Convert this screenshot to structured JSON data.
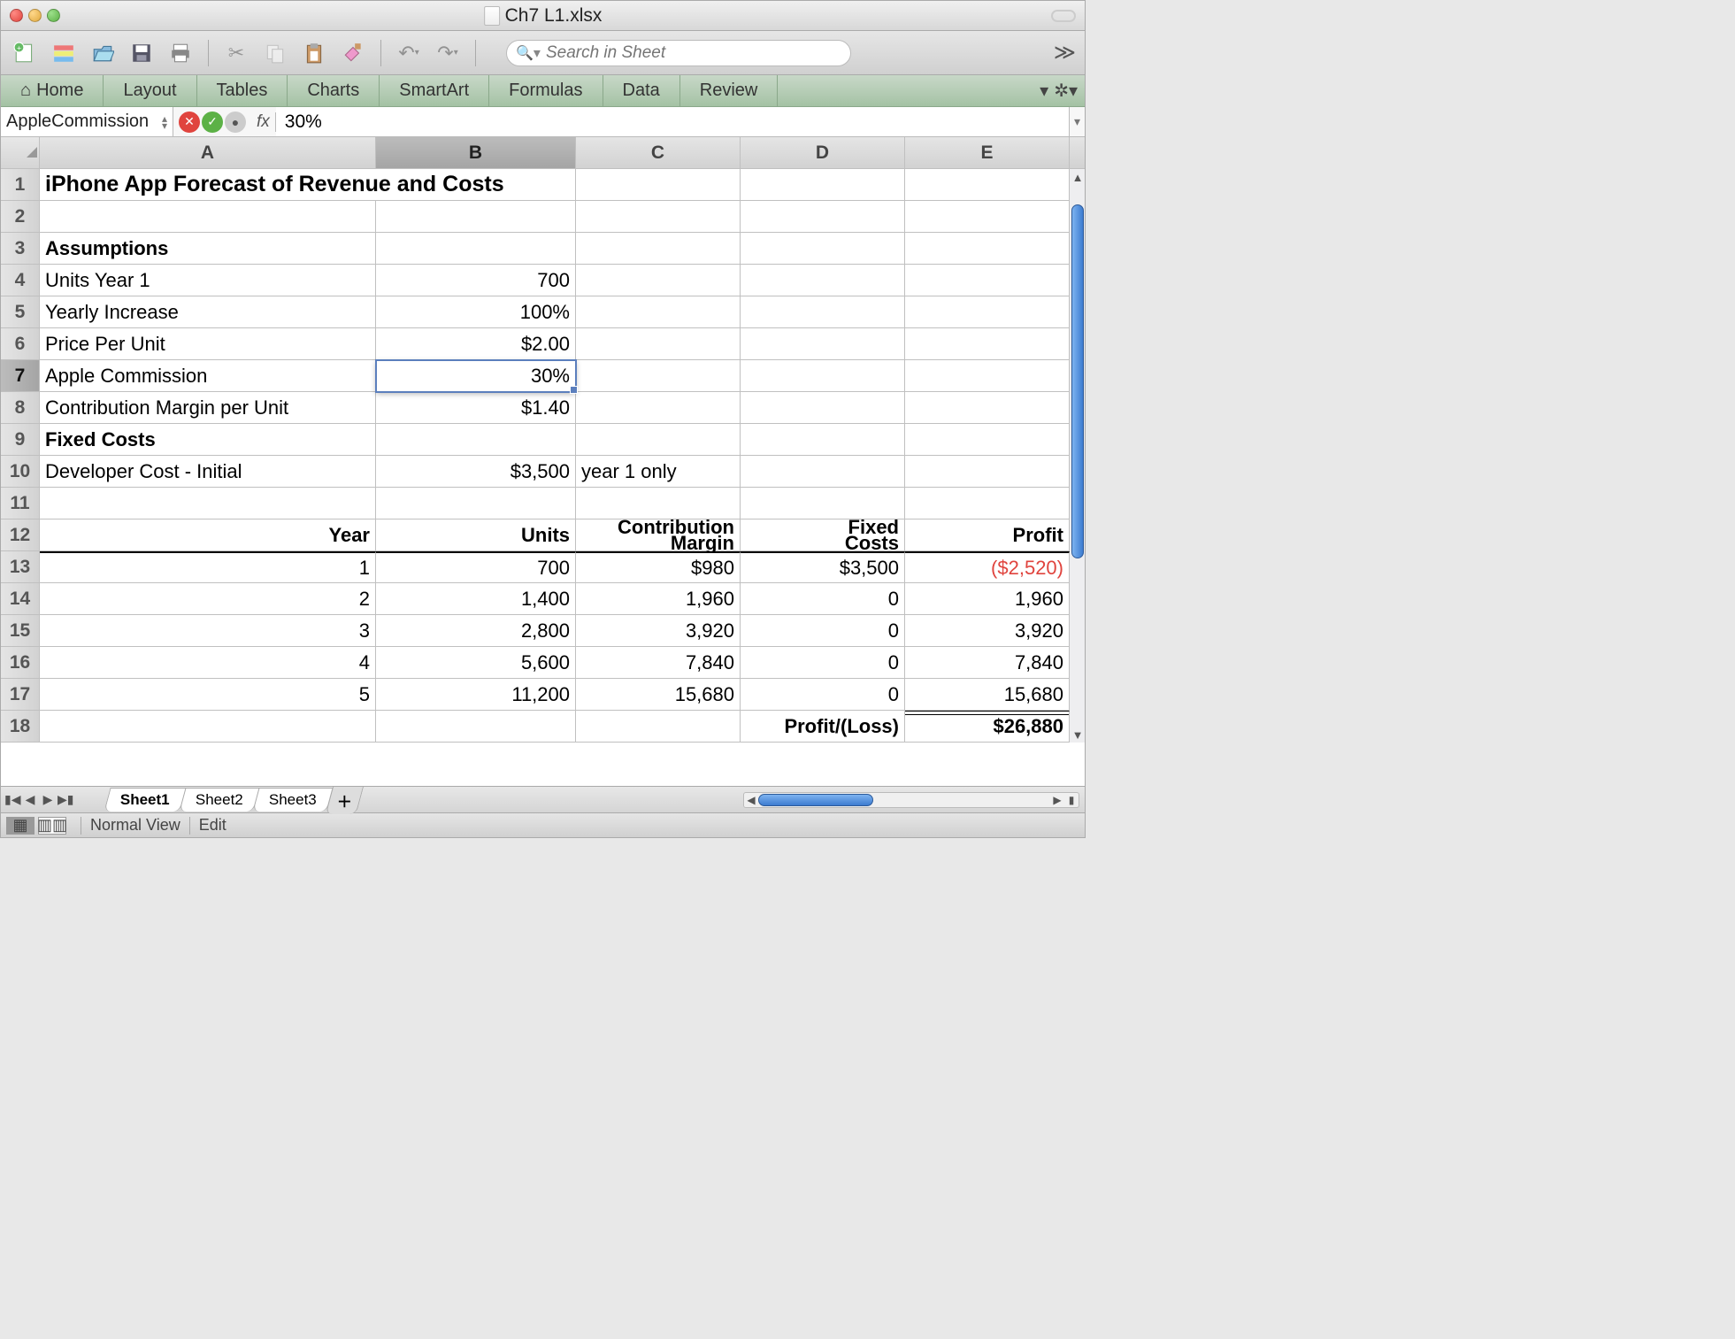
{
  "window": {
    "title": "Ch7 L1.xlsx"
  },
  "toolbar": {
    "search_placeholder": "Search in Sheet"
  },
  "ribbon": {
    "tabs": [
      "Home",
      "Layout",
      "Tables",
      "Charts",
      "SmartArt",
      "Formulas",
      "Data",
      "Review"
    ]
  },
  "formula_bar": {
    "name_box": "AppleCommission",
    "fx_label": "fx",
    "value": "30%"
  },
  "grid": {
    "columns": [
      "A",
      "B",
      "C",
      "D",
      "E"
    ],
    "selected_row": 7,
    "selected_col": "B",
    "rows": [
      {
        "n": 1,
        "A": "iPhone App Forecast of Revenue and Costs",
        "A_style": "title1 bold",
        "span": 2
      },
      {
        "n": 2
      },
      {
        "n": 3,
        "A": "Assumptions",
        "A_style": "bold"
      },
      {
        "n": 4,
        "A": "Units Year 1",
        "B": "700",
        "B_align": "right"
      },
      {
        "n": 5,
        "A": "Yearly Increase",
        "B": "100%",
        "B_align": "right"
      },
      {
        "n": 6,
        "A": "Price Per Unit",
        "B": "$2.00",
        "B_align": "right"
      },
      {
        "n": 7,
        "A": "Apple Commission",
        "B": "30%",
        "B_align": "right",
        "B_sel": true
      },
      {
        "n": 8,
        "A": "Contribution Margin per Unit",
        "B": "$1.40",
        "B_align": "right"
      },
      {
        "n": 9,
        "A": "Fixed  Costs",
        "A_style": "bold"
      },
      {
        "n": 10,
        "A": "Developer Cost - Initial",
        "B": "$3,500",
        "B_align": "right",
        "C": "year 1 only"
      },
      {
        "n": 11
      },
      {
        "n": 12,
        "A": "Year",
        "A_align": "right",
        "A_style": "bold",
        "B": "Units",
        "B_align": "right",
        "B_style": "bold",
        "C": "Contribution Margin",
        "C_align": "right",
        "C_style": "bold",
        "C_two": true,
        "D": "Fixed Costs",
        "D_align": "right",
        "D_style": "bold",
        "D_two": true,
        "E": "Profit",
        "E_align": "right",
        "E_style": "bold"
      },
      {
        "n": 13,
        "top": true,
        "A": "1",
        "A_align": "right",
        "B": "700",
        "B_align": "right",
        "C": "$980",
        "C_align": "right",
        "D": "$3,500",
        "D_align": "right",
        "E": "($2,520)",
        "E_align": "right",
        "E_style": "red"
      },
      {
        "n": 14,
        "A": "2",
        "A_align": "right",
        "B": "1,400",
        "B_align": "right",
        "C": "1,960",
        "C_align": "right",
        "D": "0",
        "D_align": "right",
        "E": "1,960",
        "E_align": "right"
      },
      {
        "n": 15,
        "A": "3",
        "A_align": "right",
        "B": "2,800",
        "B_align": "right",
        "C": "3,920",
        "C_align": "right",
        "D": "0",
        "D_align": "right",
        "E": "3,920",
        "E_align": "right"
      },
      {
        "n": 16,
        "A": "4",
        "A_align": "right",
        "B": "5,600",
        "B_align": "right",
        "C": "7,840",
        "C_align": "right",
        "D": "0",
        "D_align": "right",
        "E": "7,840",
        "E_align": "right"
      },
      {
        "n": 17,
        "A": "5",
        "A_align": "right",
        "B": "11,200",
        "B_align": "right",
        "C": "15,680",
        "C_align": "right",
        "D": "0",
        "D_align": "right",
        "E": "15,680",
        "E_align": "right"
      },
      {
        "n": 18,
        "D": "Profit/(Loss)",
        "D_align": "right",
        "D_style": "bold",
        "E": "$26,880",
        "E_align": "right",
        "E_style": "bold",
        "E_dbl": true
      }
    ]
  },
  "sheets": {
    "tabs": [
      "Sheet1",
      "Sheet2",
      "Sheet3"
    ],
    "active": 0
  },
  "status": {
    "view": "Normal View",
    "mode": "Edit"
  }
}
